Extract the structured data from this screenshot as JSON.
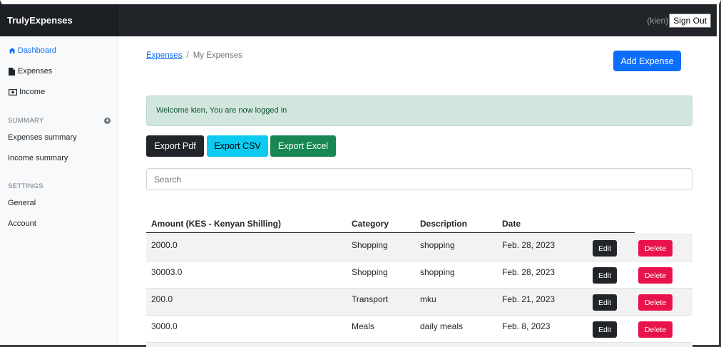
{
  "app": {
    "brand": "TrulyExpenses"
  },
  "header": {
    "username": "(kien)",
    "signout_label": "Sign Out"
  },
  "sidebar": {
    "nav": [
      {
        "label": "Dashboard",
        "icon": "home-icon",
        "active": true
      },
      {
        "label": "Expenses",
        "icon": "file-icon",
        "active": false
      },
      {
        "label": "Income",
        "icon": "money-bill-icon",
        "active": false
      }
    ],
    "summary_heading": "SUMMARY",
    "summary_items": [
      {
        "label": "Expenses summary"
      },
      {
        "label": "Income summary"
      }
    ],
    "settings_heading": "SETTINGS",
    "settings_items": [
      {
        "label": "General"
      },
      {
        "label": "Account"
      }
    ]
  },
  "breadcrumb": {
    "link": "Expenses",
    "separator": "/",
    "current": "My Expenses"
  },
  "actions": {
    "add_label": "Add Expense"
  },
  "alert": {
    "message": "Welcome kien, You are now logged in"
  },
  "exports": {
    "pdf": "Export Pdf",
    "csv": "Export CSV",
    "excel": "Export Excel"
  },
  "search": {
    "placeholder": "Search",
    "value": ""
  },
  "table": {
    "headers": {
      "amount": "Amount (KES - Kenyan Shilling)",
      "category": "Category",
      "description": "Description",
      "date": "Date"
    },
    "edit_label": "Edit",
    "delete_label": "Delete",
    "rows": [
      {
        "amount": "2000.0",
        "category": "Shopping",
        "description": "shopping",
        "date": "Feb. 28, 2023"
      },
      {
        "amount": "30003.0",
        "category": "Shopping",
        "description": "shopping",
        "date": "Feb. 28, 2023"
      },
      {
        "amount": "200.0",
        "category": "Transport",
        "description": "mku",
        "date": "Feb. 21, 2023"
      },
      {
        "amount": "3000.0",
        "category": "Meals",
        "description": "daily meals",
        "date": "Feb. 8, 2023"
      }
    ]
  },
  "colors": {
    "primary": "#0d6efd",
    "dark": "#212529",
    "info": "#0dcaf0",
    "success": "#198754",
    "danger": "#e8134a",
    "alert_bg": "#d1e7dd"
  }
}
